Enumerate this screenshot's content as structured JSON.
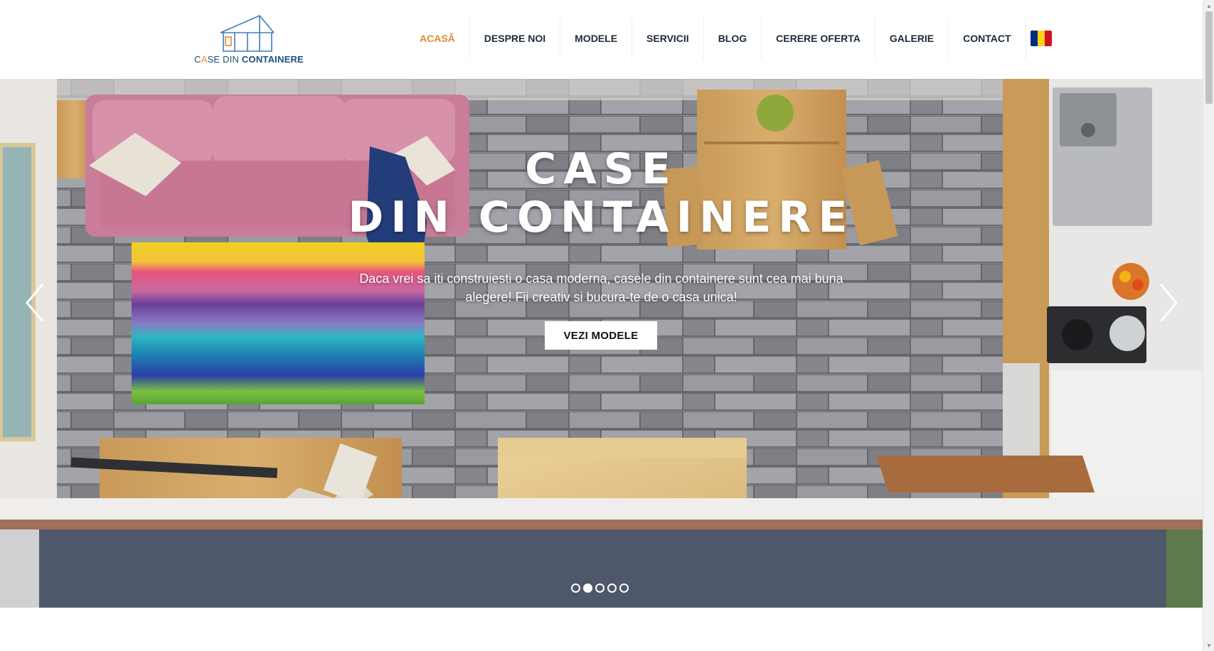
{
  "header": {
    "logo": {
      "text_part1": "C",
      "text_accent": "A",
      "text_part2": "SE DIN ",
      "text_bold": "CONTAINERE",
      "colors": {
        "main": "#1e4f7a",
        "accent": "#e8892b",
        "house_line": "#3b7fc0"
      }
    },
    "nav": {
      "items": [
        {
          "label": "ACASĂ",
          "active": true
        },
        {
          "label": "DESPRE NOI"
        },
        {
          "label": "MODELE"
        },
        {
          "label": "SERVICII"
        },
        {
          "label": "BLOG"
        },
        {
          "label": "CERERE OFERTA"
        },
        {
          "label": "GALERIE"
        },
        {
          "label": "CONTACT"
        }
      ],
      "language_flag": {
        "icon": "romania-flag-icon",
        "colors": [
          "#002b7f",
          "#fcd116",
          "#ce1126"
        ]
      },
      "active_color": "#e8892b",
      "text_color": "#1c2a3a"
    }
  },
  "hero": {
    "title_line1": "CASE",
    "title_line2": "DIN CONTAINERE",
    "subtitle_line1": "Daca vrei sa iti construiesti o casa moderna, casele din containere sunt cea mai buna",
    "subtitle_line2": "alegere! Fii creativ si bucura-te de o casa unica!",
    "button_label": "VEZI MODELE",
    "prev_icon": "chevron-left-icon",
    "next_icon": "chevron-right-icon",
    "slides_count": 5,
    "active_slide": 2
  },
  "scrollbar": {
    "up_icon": "scroll-up-arrow-icon",
    "down_icon": "scroll-down-arrow-icon",
    "up_glyph": "▲",
    "down_glyph": "▼"
  }
}
